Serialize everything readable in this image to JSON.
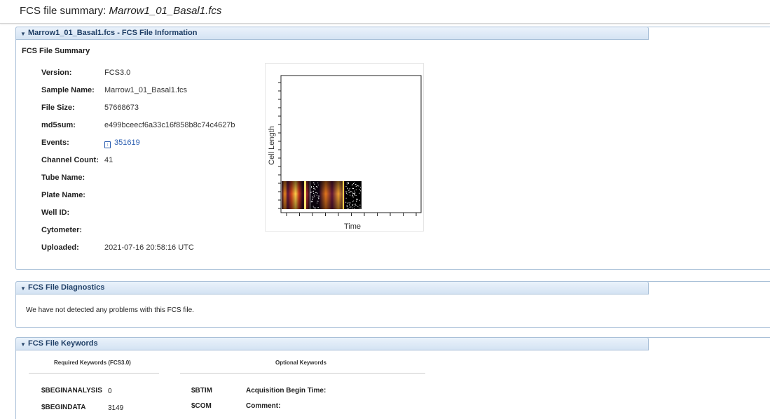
{
  "header": {
    "prefix": "FCS file summary: ",
    "filename": "Marrow1_01_Basal1.fcs"
  },
  "info_panel": {
    "title": "Marrow1_01_Basal1.fcs - FCS File Information",
    "section_title": "FCS File Summary",
    "rows": [
      {
        "label": "Version:",
        "value": "FCS3.0"
      },
      {
        "label": "Sample Name:",
        "value": "Marrow1_01_Basal1.fcs"
      },
      {
        "label": "File Size:",
        "value": "57668673"
      },
      {
        "label": "md5sum:",
        "value": "e499bceecf6a33c16f858b8c74c4627b"
      },
      {
        "label": "Events:",
        "value": "351619"
      },
      {
        "label": "Channel Count:",
        "value": "41"
      },
      {
        "label": "Tube Name:",
        "value": ""
      },
      {
        "label": "Plate Name:",
        "value": ""
      },
      {
        "label": "Well ID:",
        "value": ""
      },
      {
        "label": "Cytometer:",
        "value": ""
      },
      {
        "label": "Uploaded:",
        "value": "2021-07-16 20:58:16 UTC"
      }
    ],
    "plot": {
      "xlabel": "Time",
      "ylabel": "Cell Length"
    }
  },
  "diagnostics_panel": {
    "title": "FCS File Diagnostics",
    "message": "We have not detected any problems with this FCS file."
  },
  "keywords_panel": {
    "title": "FCS File Keywords",
    "required_header": "Required Keywords (FCS3.0)",
    "optional_header": "Optional Keywords",
    "required": [
      {
        "name": "$BEGINANALYSIS",
        "value": "0"
      },
      {
        "name": "$BEGINDATA",
        "value": "3149"
      }
    ],
    "optional": [
      {
        "name": "$BTIM",
        "desc": "Acquisition Begin Time:"
      },
      {
        "name": "$COM",
        "desc": "Comment:"
      }
    ]
  },
  "icons": {
    "download": "download-icon",
    "collapse": "caret-down-icon"
  }
}
